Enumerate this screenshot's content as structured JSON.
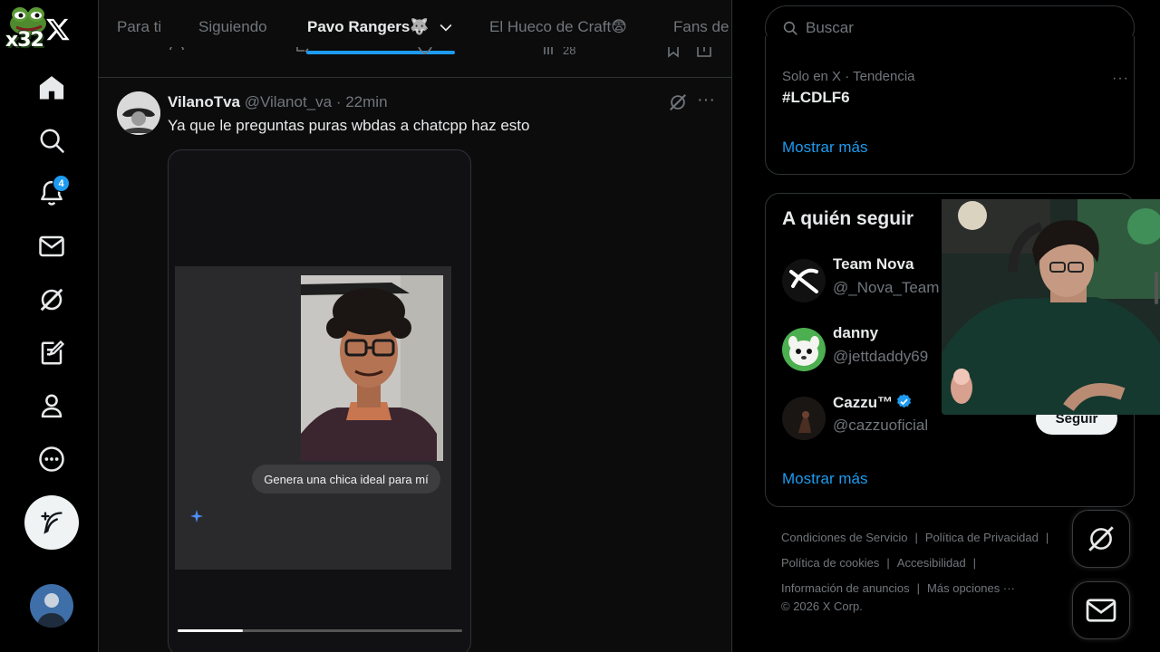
{
  "sidebar": {
    "logo_text": "x32",
    "notifications_badge": "4"
  },
  "tabs": [
    {
      "label": "Para ti"
    },
    {
      "label": "Siguiendo"
    },
    {
      "label": "Pavo Rangers🐺"
    },
    {
      "label": "El Hueco de Craft😨"
    },
    {
      "label": "Fans de"
    }
  ],
  "prev_post": {
    "views": "28"
  },
  "post": {
    "name": "VilanoTva",
    "handle": "@Vilanot_va",
    "separator": "·",
    "time": "22min",
    "text": "Ya que le preguntas puras wbdas a chatcpp haz esto",
    "video": {
      "prompt_text": "Genera una chica ideal para mí",
      "progress": 0.23
    }
  },
  "search": {
    "placeholder": "Buscar"
  },
  "trends": {
    "meta": "Solo en X · Tendencia",
    "tag": "#LCDLF6",
    "more_label": "···",
    "show_more": "Mostrar más"
  },
  "who_to_follow": {
    "title": "A quién seguir",
    "accounts": [
      {
        "name": "Team Nova",
        "handle": "@_Nova_Team"
      },
      {
        "name": "danny",
        "handle": "@jettdaddy69"
      },
      {
        "name": "Cazzu™",
        "handle": "@cazzuoficial",
        "verified": true
      }
    ],
    "follow_label": "Seguir",
    "show_more": "Mostrar más"
  },
  "footer": {
    "links": [
      "Condiciones de Servicio",
      "Política de Privacidad",
      "Política de cookies",
      "Accesibilidad",
      "Información de anuncios",
      "Más opciones ···"
    ],
    "separator": "|",
    "copyright": "© 2026 X Corp."
  },
  "colors": {
    "accent": "#1d9bf0",
    "background": "#000000",
    "text_primary": "#e7e9ea",
    "text_secondary": "#71767b",
    "border": "#2f3336"
  }
}
